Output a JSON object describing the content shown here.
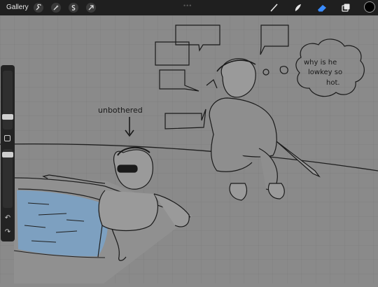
{
  "app": {
    "gallery_label": "Gallery",
    "top_dots": "•••"
  },
  "left_tools": [
    {
      "name": "wrench-icon"
    },
    {
      "name": "magic-wand-icon"
    },
    {
      "name": "selection-icon"
    },
    {
      "name": "transform-arrow-icon"
    }
  ],
  "right_tools": [
    {
      "name": "brush-icon",
      "active": false
    },
    {
      "name": "smudge-icon",
      "active": false
    },
    {
      "name": "eraser-icon",
      "active": true
    },
    {
      "name": "layers-icon",
      "active": false
    }
  ],
  "colors": {
    "accent": "#3a8cff",
    "current_color": "#000000",
    "canvas_bg": "#8a8a8a",
    "pool_water": "#7aa3c9"
  },
  "sidebar": {
    "undo_glyph": "↶",
    "redo_glyph": "↷",
    "modify_label": ""
  },
  "drawing": {
    "caption_left": "unbothered",
    "thought_line1": "why is he",
    "thought_line2": "lowkey so",
    "thought_line3": "hot."
  }
}
